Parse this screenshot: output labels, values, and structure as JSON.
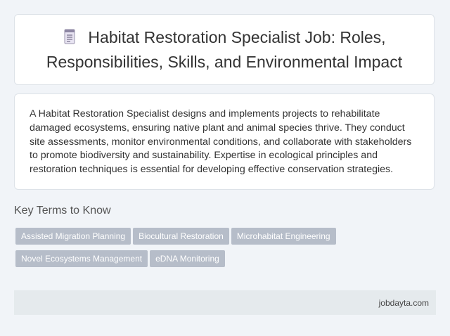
{
  "header": {
    "title": "Habitat Restoration Specialist Job: Roles, Responsibilities, Skills, and Environmental Impact",
    "icon": "document-icon"
  },
  "description": "A Habitat Restoration Specialist designs and implements projects to rehabilitate damaged ecosystems, ensuring native plant and animal species thrive. They conduct site assessments, monitor environmental conditions, and collaborate with stakeholders to promote biodiversity and sustainability. Expertise in ecological principles and restoration techniques is essential for developing effective conservation strategies.",
  "key_terms": {
    "heading": "Key Terms to Know",
    "items": [
      "Assisted Migration Planning",
      "Biocultural Restoration",
      "Microhabitat Engineering",
      "Novel Ecosystems Management",
      "eDNA Monitoring"
    ]
  },
  "footer": {
    "site": "jobdayta.com"
  },
  "colors": {
    "page_bg": "#f1f4f8",
    "card_bg": "#ffffff",
    "tag_bg": "#b6bdc9",
    "footer_bg": "#e5eaed"
  }
}
